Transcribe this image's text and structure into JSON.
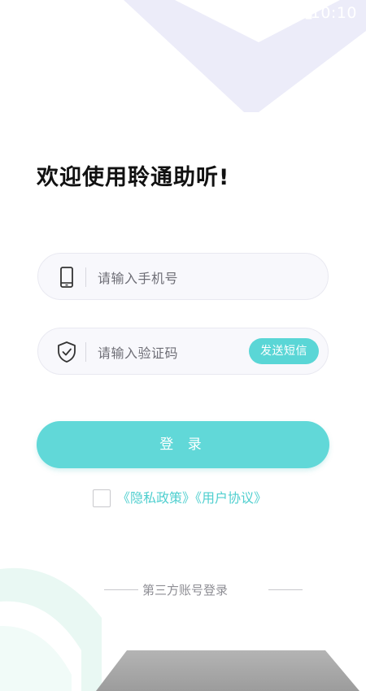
{
  "status_bar": {
    "time": "10:10",
    "battery_icon": "battery-icon"
  },
  "welcome": {
    "title": "欢迎使用聆通助听!"
  },
  "phone_field": {
    "icon": "phone-icon",
    "placeholder": "请输入手机号"
  },
  "code_field": {
    "icon": "shield-check-icon",
    "placeholder": "请输入验证码",
    "send_sms_label": "发送短信"
  },
  "login_button": {
    "label": "登 录"
  },
  "agreement": {
    "checked": false,
    "privacy_policy_label": "《隐私政策》",
    "user_agreement_label": "《用户协议》"
  },
  "third_party": {
    "label": "第三方账号登录"
  },
  "colors": {
    "accent": "#61d8d8",
    "link": "#4fcfcf",
    "decor_lavender": "#e8e8f8",
    "decor_mint": "#eaf8f4",
    "decor_gray": "#a8a8a8"
  }
}
